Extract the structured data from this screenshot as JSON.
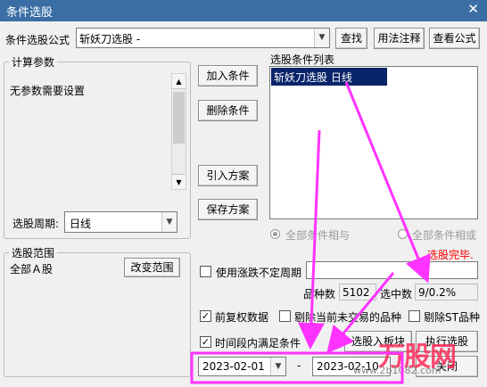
{
  "window": {
    "title": "条件选股",
    "close_glyph": "✕"
  },
  "formula": {
    "label": "条件选股公式",
    "value": "斩妖刀选股   -",
    "find": "查找",
    "usage": "用法注释",
    "view": "查看公式"
  },
  "params": {
    "legend": "计算参数",
    "text": "无参数需要设置"
  },
  "period": {
    "label": "选股周期:",
    "value": "日线"
  },
  "conditions": {
    "legend": "选股条件列表",
    "items": [
      "斩妖刀选股  日线"
    ],
    "add": "加入条件",
    "delete": "删除条件",
    "import": "引入方案",
    "save": "保存方案",
    "radio_and": "全部条件相与",
    "radio_or": "全部条件相或"
  },
  "status": {
    "done": "选股完毕.",
    "variety_label": "品种数",
    "variety_value": "5102",
    "selected_label": "选中数",
    "selected_value": "9/0.2%"
  },
  "range": {
    "legend": "选股范围",
    "value": "全部Ａ股",
    "change": "改变范围"
  },
  "options": {
    "variable_period": "使用涨跌不定周期",
    "pre_adjust": "前复权数据",
    "exclude_untraded": "剔除当前未交易的品种",
    "exclude_st": "剔除ST品种",
    "time_range": "时间段内满足条件",
    "check_mark": "✓"
  },
  "dates": {
    "start": "2023-02-01",
    "dash": "-",
    "end": "2023-02-10"
  },
  "actions": {
    "select_to_board": "选股入板块",
    "run": "执行选股",
    "close": "关闭"
  },
  "watermark": {
    "brand": "万股网",
    "site": "www.2b1082.com"
  },
  "colors": {
    "titlebar": "#3a6ea5",
    "selection": "#0a246a",
    "done": "#ff0000",
    "annotation": "#ff33ff"
  },
  "icons": {
    "dropdown": "▼",
    "scroll_up": "▲",
    "scroll_down": "▼"
  }
}
